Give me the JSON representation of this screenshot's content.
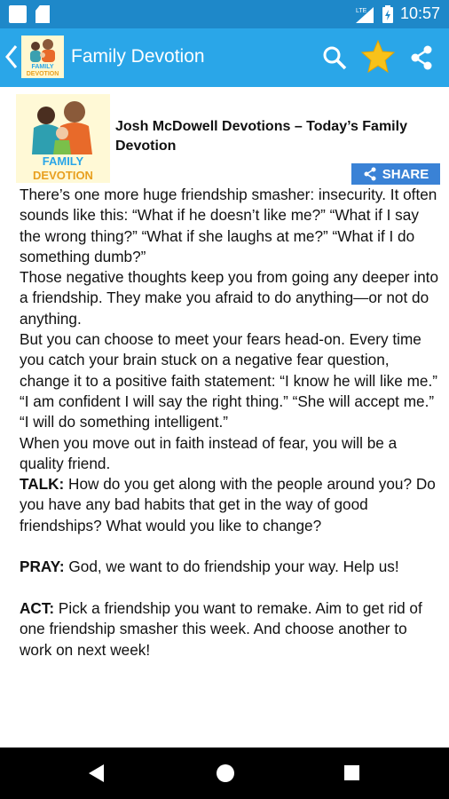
{
  "status_bar": {
    "time": "10:57",
    "icons": [
      "notification-square-icon",
      "sd-card-icon",
      "lte-signal-icon",
      "battery-icon"
    ]
  },
  "app_bar": {
    "title": "Family Devotion",
    "icons": [
      "back-chevron-icon",
      "search-icon",
      "star-icon",
      "share-icon"
    ],
    "accent_color": "#2aa6e8",
    "status_color": "#1e88c9"
  },
  "logo": {
    "text_line1": "FAMILY",
    "text_line2": "DEVOTION"
  },
  "post": {
    "title": "Josh McDowell Devotions – Today’s Family Devotion",
    "share_label": "SHARE",
    "paragraphs": [
      {
        "text": "There’s one more huge friendship smasher: insecurity. It often sounds like this: “What if he doesn’t like me?” “What if I say the wrong thing?” “What if she laughs at me?” “What if I do something dumb?”"
      },
      {
        "text": "Those negative thoughts keep you from going any deeper into a friendship. They make you afraid to do anything—or not do anything."
      },
      {
        "text": "But you can choose to meet your fears head-on. Every time you catch your brain stuck on a negative fear question, change it to a positive faith statement: “I know he will like me.” “I am confident I will say the right thing.” “She will accept me.” “I will do something intelligent.”"
      },
      {
        "text": "When you move out in faith instead of fear, you will be a quality friend."
      },
      {
        "label": "TALK:",
        "text": " How do you get along with the people around you? Do you have any bad habits that get in the way of good friendships? What would you like to change?"
      },
      {
        "label": "PRAY:",
        "text": " God, we want to do friendship your way. Help us!"
      },
      {
        "label": "ACT:",
        "text": " Pick a friendship you want to remake. Aim to get rid of one friendship smasher this week. And choose another to work on next week!"
      }
    ]
  },
  "nav_bar": {
    "icons": [
      "back-triangle-icon",
      "home-circle-icon",
      "recents-square-icon"
    ]
  }
}
